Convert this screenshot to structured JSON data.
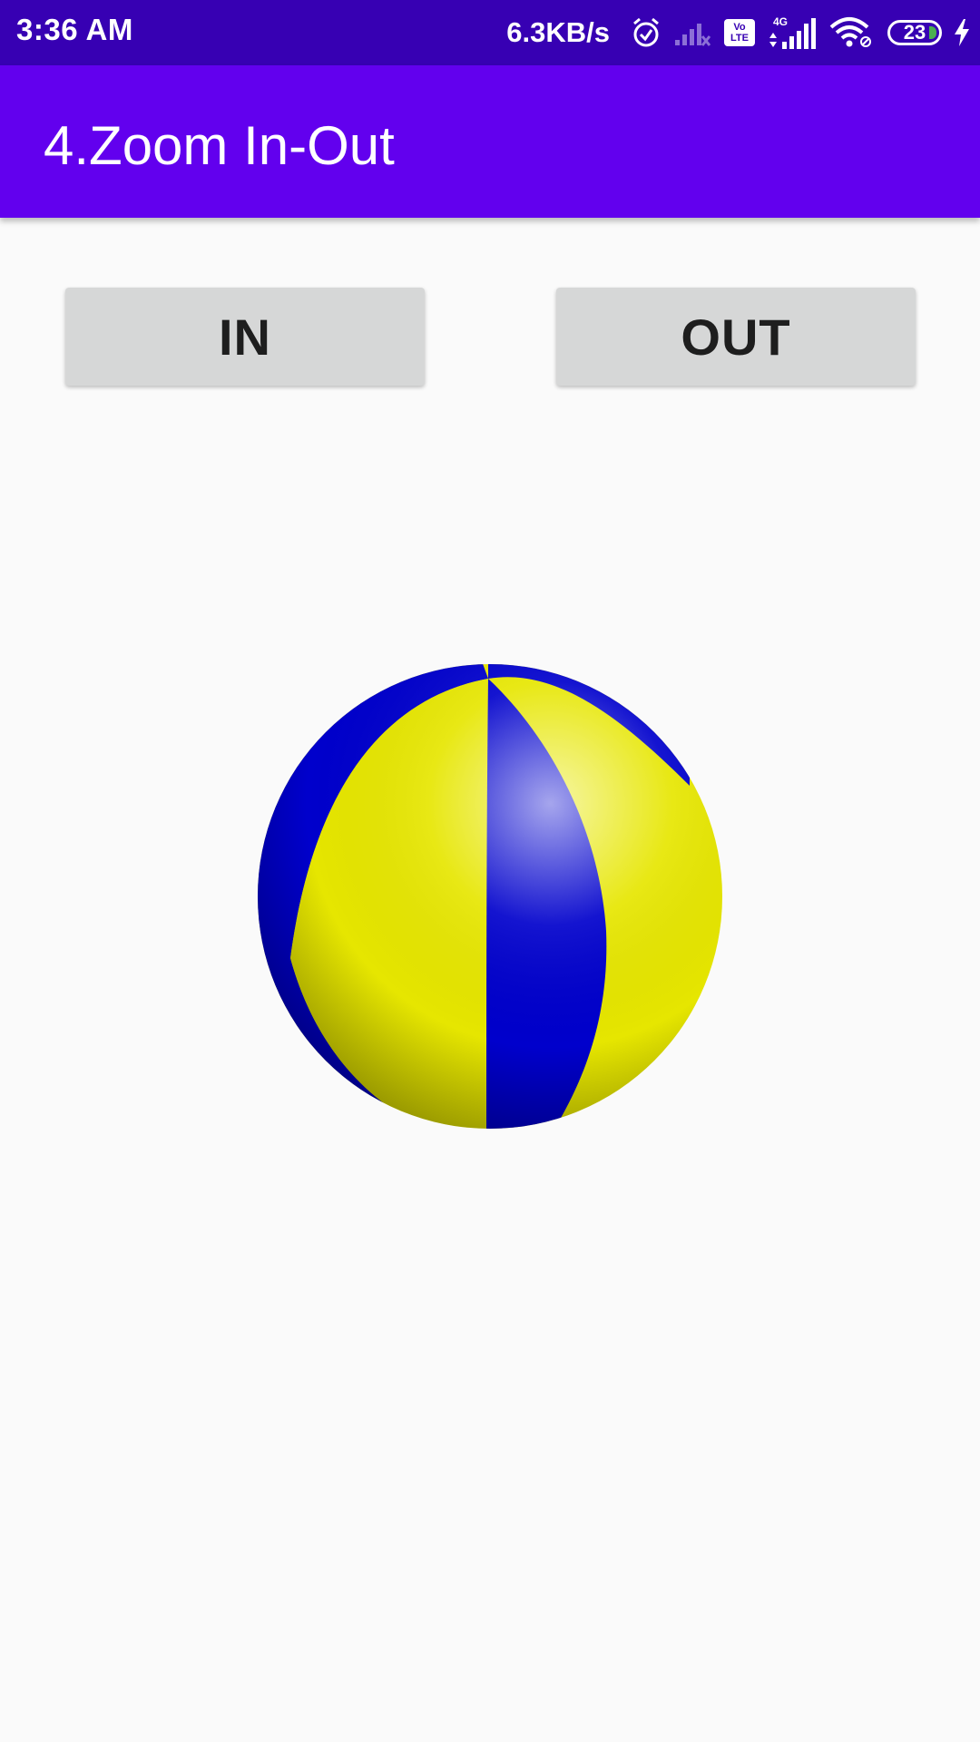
{
  "status_bar": {
    "time": "3:36 AM",
    "net_speed": "6.3KB/s",
    "volte": [
      "Vo",
      "LTE"
    ],
    "network_type": "4G",
    "battery": "23",
    "icons": [
      "alarm-icon",
      "signal-off-icon",
      "volte-icon",
      "signal-icon",
      "wifi-icon",
      "battery-icon",
      "charging-icon"
    ]
  },
  "app_bar": {
    "title": "4.Zoom In-Out"
  },
  "buttons": {
    "in_label": "IN",
    "out_label": "OUT"
  },
  "image": {
    "name": "beach-ball",
    "colors": {
      "blue": "#0000cc",
      "yellow": "#e6e600"
    }
  },
  "colors": {
    "status_bar": "#3700b3",
    "app_bar": "#6200ee",
    "button": "#d6d7d7",
    "background": "#fafafa"
  }
}
